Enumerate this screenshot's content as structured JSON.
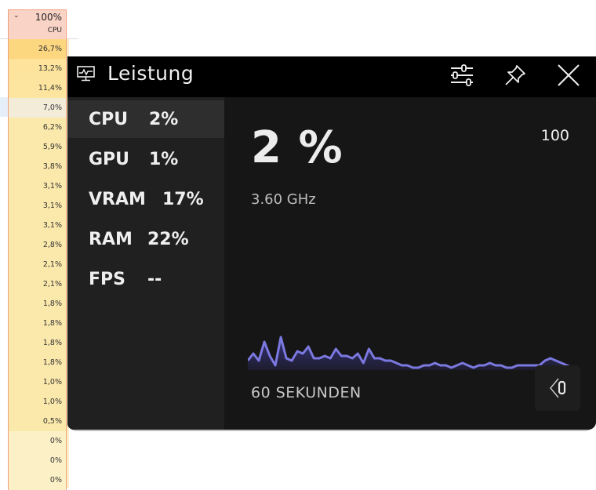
{
  "task_manager": {
    "column_header": {
      "total_percent": "100%",
      "label": "CPU",
      "sort_icon": "chevron-down-icon"
    },
    "values": [
      "26,7%",
      "13,2%",
      "11,4%",
      "7,0%",
      "6,2%",
      "5,9%",
      "3,8%",
      "3,1%",
      "3,1%",
      "3,1%",
      "2,8%",
      "2,1%",
      "2,1%",
      "1,8%",
      "1,8%",
      "1,8%",
      "1,8%",
      "1,0%",
      "1,0%",
      "0,5%",
      "0%",
      "0%",
      "0%"
    ],
    "row_colors": [
      "#fdd680",
      "#fde39b",
      "#fde59f",
      "#f2ecd9",
      "#fbe8ab",
      "#fbe8ab",
      "#fbe8ab",
      "#fbe8ab",
      "#fbe8ab",
      "#fbe8ab",
      "#fbe8ab",
      "#fbe8ab",
      "#fbe8ab",
      "#fbe8ab",
      "#fbe8ab",
      "#fbe8ab",
      "#fbe8ab",
      "#fbe8ab",
      "#fbe8ab",
      "#fbe8ab",
      "#fcf1c6",
      "#fcf1c6",
      "#fcf1c6"
    ]
  },
  "widget": {
    "title": "Leistung",
    "title_icon": "performance-monitor-icon",
    "toolbar": {
      "settings_icon": "sliders-icon",
      "pin_icon": "pin-icon",
      "close_icon": "close-icon"
    },
    "metrics": [
      {
        "name": "CPU",
        "value": "2%"
      },
      {
        "name": "GPU",
        "value": "1%"
      },
      {
        "name": "VRAM",
        "value": "17%"
      },
      {
        "name": "RAM",
        "value": "22%"
      },
      {
        "name": "FPS",
        "value": "--"
      }
    ],
    "selected_metric": "CPU",
    "detail": {
      "big_value": "2 %",
      "frequency": "3.60 GHz",
      "max_label": "100",
      "time_label": "60 SEKUNDEN",
      "corner_button_icon": "collapse-left-icon"
    },
    "colors": {
      "line": "#7b78e0",
      "fill": "#3a3788"
    }
  },
  "chart_data": {
    "type": "area",
    "title": "CPU",
    "xlabel": "60 SEKUNDEN",
    "ylabel": "",
    "ylim": [
      0,
      100
    ],
    "x_seconds": [
      0,
      1,
      2,
      3,
      4,
      5,
      6,
      7,
      8,
      9,
      10,
      11,
      12,
      13,
      14,
      15,
      16,
      17,
      18,
      19,
      20,
      21,
      22,
      23,
      24,
      25,
      26,
      27,
      28,
      29,
      30,
      31,
      32,
      33,
      34,
      35,
      36,
      37,
      38,
      39,
      40,
      41,
      42,
      43,
      44,
      45,
      46,
      47,
      48,
      49,
      50,
      51,
      52,
      53,
      54,
      55,
      56,
      57,
      58,
      59
    ],
    "values": [
      4,
      7,
      4,
      12,
      6,
      2,
      14,
      5,
      4,
      8,
      7,
      10,
      5,
      5,
      6,
      5,
      9,
      6,
      6,
      5,
      7,
      3,
      9,
      5,
      5,
      4,
      4,
      3,
      2,
      2,
      1,
      1,
      2,
      2,
      3,
      2,
      2,
      1,
      2,
      3,
      2,
      1,
      2,
      2,
      3,
      2,
      2,
      1,
      1,
      2,
      2,
      2,
      2,
      2,
      4,
      5,
      4,
      3,
      2,
      1
    ]
  }
}
